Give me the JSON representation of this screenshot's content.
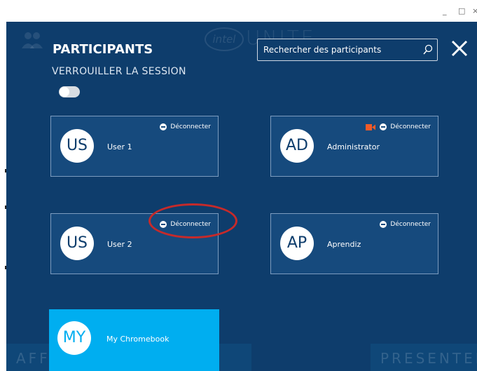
{
  "window": {
    "controls": {
      "minimize": "_",
      "maximize": "□",
      "close": "×"
    }
  },
  "background": {
    "logo_text": "intel",
    "brand_text": "UNITE",
    "bottom_left_text": "AFF",
    "bottom_right_text": "PRESENTER"
  },
  "panel": {
    "title": "PARTICIPANTS",
    "lock_label": "VERROUILLER LA SESSION",
    "lock_enabled": false,
    "search_placeholder": "Rechercher des participants"
  },
  "participants": [
    {
      "initials": "US",
      "name": "User 1",
      "action": "Déconnecter",
      "presenting": false
    },
    {
      "initials": "AD",
      "name": "Administrator",
      "action": "Déconnecter",
      "presenting": true
    },
    {
      "initials": "US",
      "name": "User 2",
      "action": "Déconnecter",
      "presenting": false
    },
    {
      "initials": "AP",
      "name": "Aprendiz",
      "action": "Déconnecter",
      "presenting": false
    }
  ],
  "self": {
    "initials": "MY",
    "name": "My Chromebook"
  },
  "colors": {
    "background": "#0e3d6c",
    "card": "#164a7d",
    "self_card": "#00aef0",
    "camera": "#f05a28",
    "annotation": "#c62a2a"
  }
}
